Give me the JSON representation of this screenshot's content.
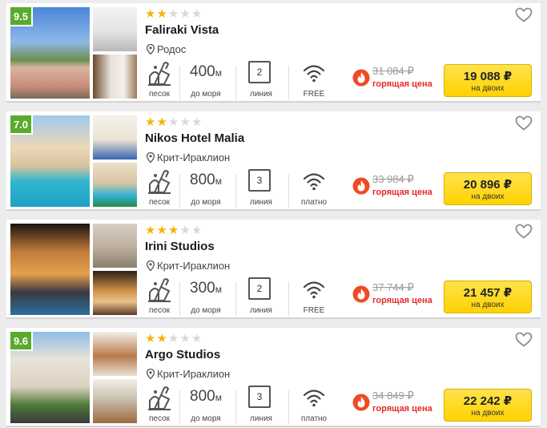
{
  "hotels": [
    {
      "score": "9.5",
      "stars": 2,
      "name": "Faliraki Vista",
      "location": "Родос",
      "beach": "песок",
      "distance_value": "400",
      "distance_unit": "м",
      "distance_label": "до моря",
      "line_number": "2",
      "line_label": "линия",
      "wifi_label": "FREE",
      "old_price": "31 084 ₽",
      "hot_label": "горящая цена",
      "price": "19 088 ₽",
      "price_sub": "на двоих"
    },
    {
      "score": "7.0",
      "stars": 2,
      "name": "Nikos Hotel Malia",
      "location": "Крит-Ираклион",
      "beach": "песок",
      "distance_value": "800",
      "distance_unit": "м",
      "distance_label": "до моря",
      "line_number": "3",
      "line_label": "линия",
      "wifi_label": "платно",
      "old_price": "33 984 ₽",
      "hot_label": "горящая цена",
      "price": "20 896 ₽",
      "price_sub": "на двоих"
    },
    {
      "score": "",
      "stars": 3,
      "name": "Irini Studios",
      "location": "Крит-Ираклион",
      "beach": "песок",
      "distance_value": "300",
      "distance_unit": "м",
      "distance_label": "до моря",
      "line_number": "2",
      "line_label": "линия",
      "wifi_label": "FREE",
      "old_price": "37 744 ₽",
      "hot_label": "горящая цена",
      "price": "21 457 ₽",
      "price_sub": "на двоих"
    },
    {
      "score": "9.6",
      "stars": 2,
      "name": "Argo Studios",
      "location": "Крит-Ираклион",
      "beach": "песок",
      "distance_value": "800",
      "distance_unit": "м",
      "distance_label": "до моря",
      "line_number": "3",
      "line_label": "линия",
      "wifi_label": "платно",
      "old_price": "34 849 ₽",
      "hot_label": "горящая цена",
      "price": "22 242 ₽",
      "price_sub": "на двоих"
    }
  ],
  "colors": {
    "score_badge": "#5aaa2c",
    "star_active": "#f5b400",
    "star_inactive": "#d8d8d8",
    "hot_red": "#e52a2a",
    "price_button": "#ffd200"
  },
  "icons": {
    "favorite": "heart-outline-icon",
    "location": "map-pin-icon",
    "beach": "sand-beach-icon",
    "wifi": "wifi-icon",
    "hot": "flame-icon"
  }
}
